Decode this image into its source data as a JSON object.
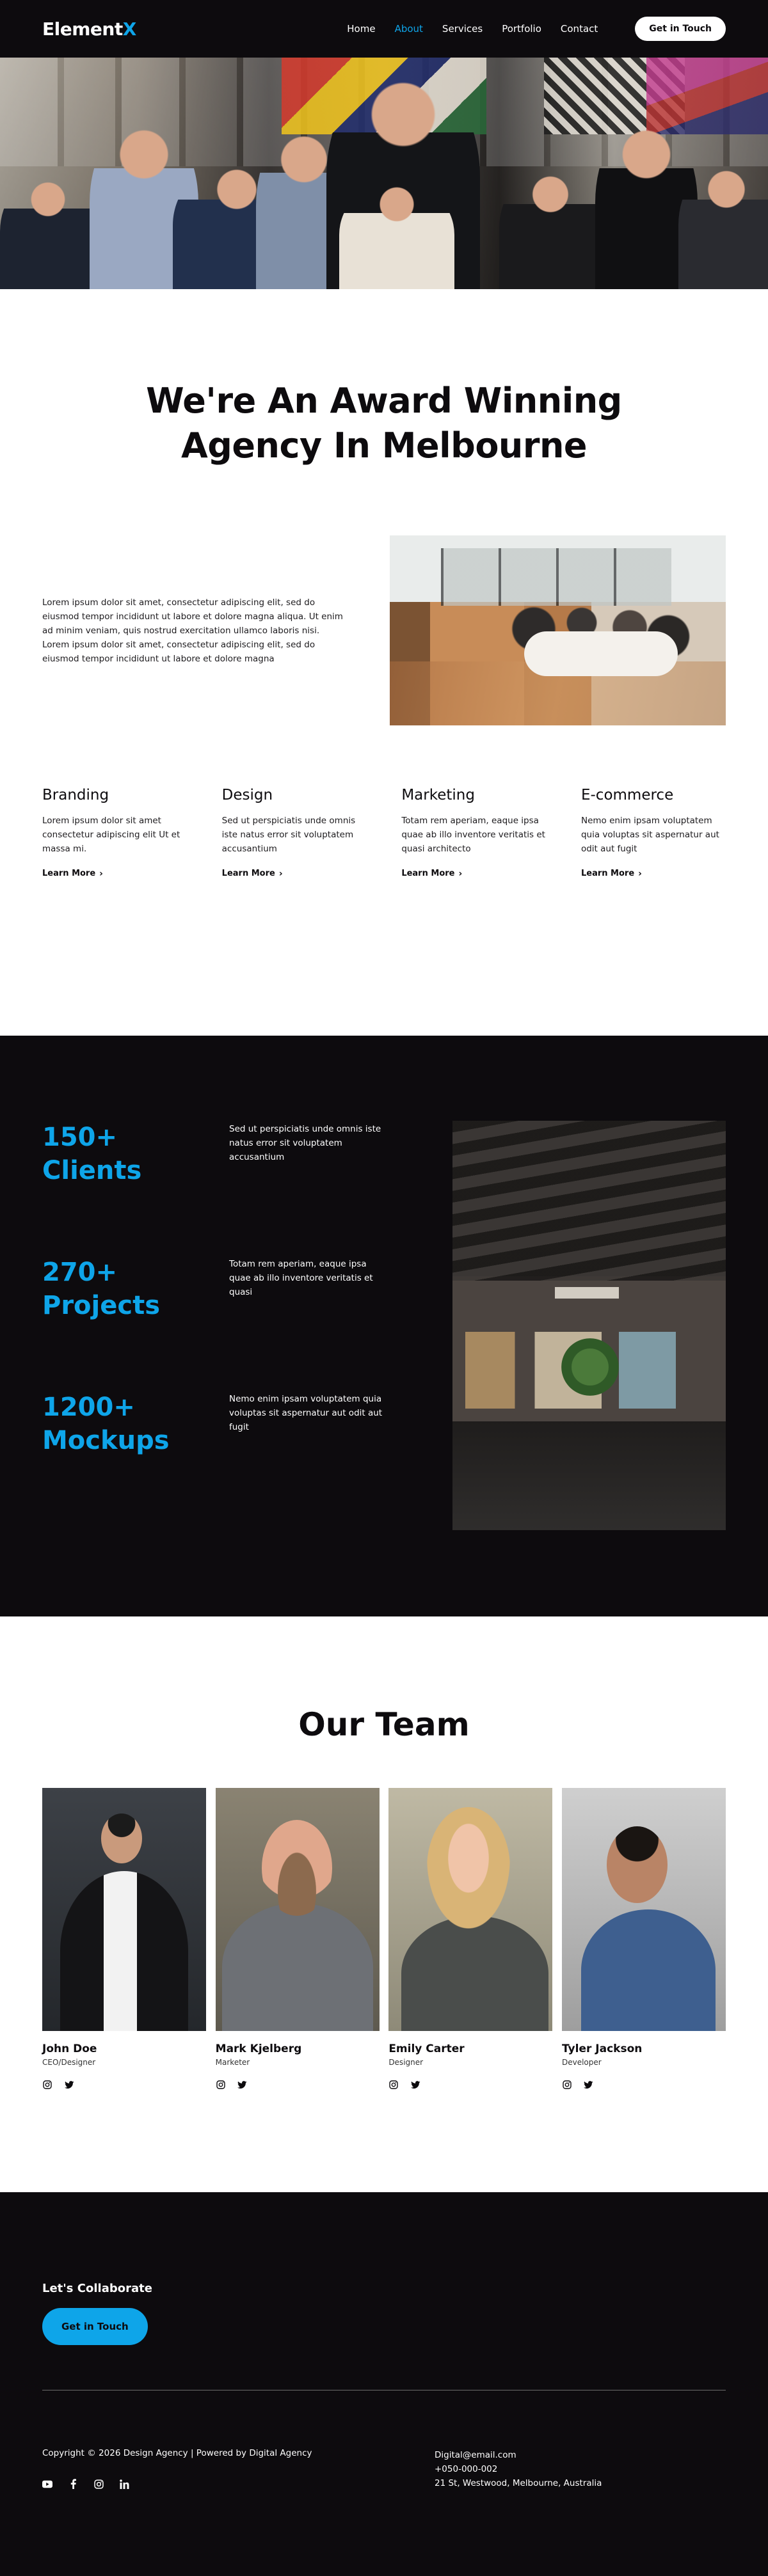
{
  "header": {
    "logo_main": "Element",
    "logo_accent": "X",
    "nav": [
      {
        "label": "Home",
        "active": false
      },
      {
        "label": "About",
        "active": true
      },
      {
        "label": "Services",
        "active": false
      },
      {
        "label": "Portfolio",
        "active": false
      },
      {
        "label": "Contact",
        "active": false
      }
    ],
    "cta_label": "Get in Touch"
  },
  "intro": {
    "title_line1": "We're An Award Winning",
    "title_line2": "Agency In Melbourne",
    "paragraph": "Lorem ipsum dolor sit amet, consectetur adipiscing elit, sed do eiusmod tempor incididunt ut labore et dolore magna aliqua. Ut enim ad minim veniam, quis nostrud exercitation ullamco laboris nisi. Lorem ipsum dolor sit amet, consectetur adipiscing elit, sed do eiusmod tempor incididunt ut labore et dolore magna"
  },
  "services": [
    {
      "title": "Branding",
      "text": "Lorem ipsum dolor sit amet consectetur adipiscing elit Ut et massa mi.",
      "link": "Learn More"
    },
    {
      "title": "Design",
      "text": "Sed ut perspiciatis unde omnis iste natus error sit voluptatem accusantium",
      "link": "Learn More"
    },
    {
      "title": "Marketing",
      "text": "Totam rem aperiam, eaque ipsa quae ab illo inventore veritatis et quasi architecto",
      "link": "Learn More"
    },
    {
      "title": "E-commerce",
      "text": "Nemo enim ipsam voluptatem quia voluptas sit aspernatur aut odit aut fugit",
      "link": "Learn More"
    }
  ],
  "stats": [
    {
      "number_line1": "150+",
      "number_line2": "Clients",
      "text": "Sed ut perspiciatis unde omnis iste natus error sit voluptatem accusantium"
    },
    {
      "number_line1": "270+",
      "number_line2": "Projects",
      "text": "Totam rem aperiam, eaque ipsa quae ab illo inventore veritatis et quasi"
    },
    {
      "number_line1": "1200+",
      "number_line2": "Mockups",
      "text": "Nemo enim ipsam voluptatem quia voluptas sit aspernatur aut odit aut fugit"
    }
  ],
  "team": {
    "title": "Our Team",
    "members": [
      {
        "name": "John Doe",
        "role": "CEO/Designer"
      },
      {
        "name": "Mark Kjelberg",
        "role": "Marketer"
      },
      {
        "name": "Emily Carter",
        "role": "Designer"
      },
      {
        "name": "Tyler Jackson",
        "role": "Developer"
      }
    ],
    "social_icons": [
      "instagram-icon",
      "twitter-icon"
    ]
  },
  "footer": {
    "heading": "Let's Collaborate",
    "cta_label": "Get in Touch",
    "copyright": "Copyright © 2026 Design Agency | Powered by Digital Agency",
    "social_icons": [
      "youtube-icon",
      "facebook-icon",
      "instagram-icon",
      "linkedin-icon"
    ],
    "email": "Digital@email.com",
    "phone": "+050-000-002",
    "address": "21 St, Westwood, Melbourne, Australia"
  },
  "colors": {
    "accent": "#0ea5e9",
    "dark": "#0d0b0e",
    "light": "#ffffff"
  }
}
